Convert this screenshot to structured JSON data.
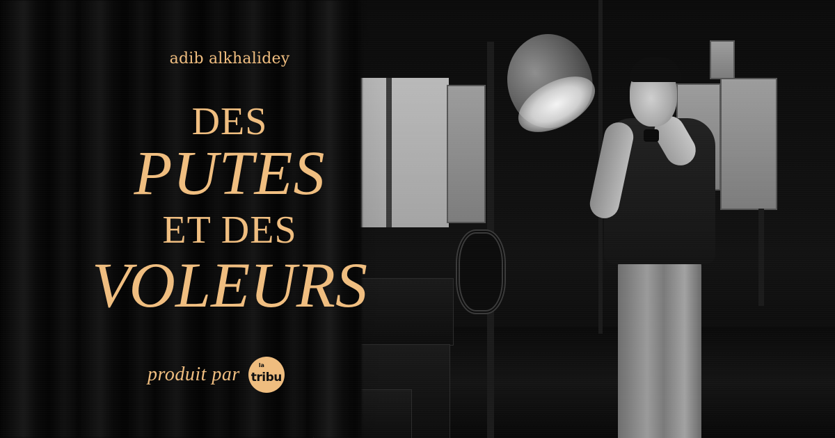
{
  "poster": {
    "author": "adib alkhalidey",
    "title": {
      "line1": "DES",
      "line2": "PUTES",
      "line3": "ET DES",
      "line4": "VOLEURS"
    },
    "producer": {
      "label": "produit par",
      "logo_small": "la",
      "logo_word": "tribu"
    },
    "colors": {
      "text_gold": "#f0be80",
      "logo_gold": "#efbd7f",
      "background": "#070707"
    },
    "photo": "black-and-white backstage photo: man in cap covering face with hands, stage light, curtain"
  }
}
